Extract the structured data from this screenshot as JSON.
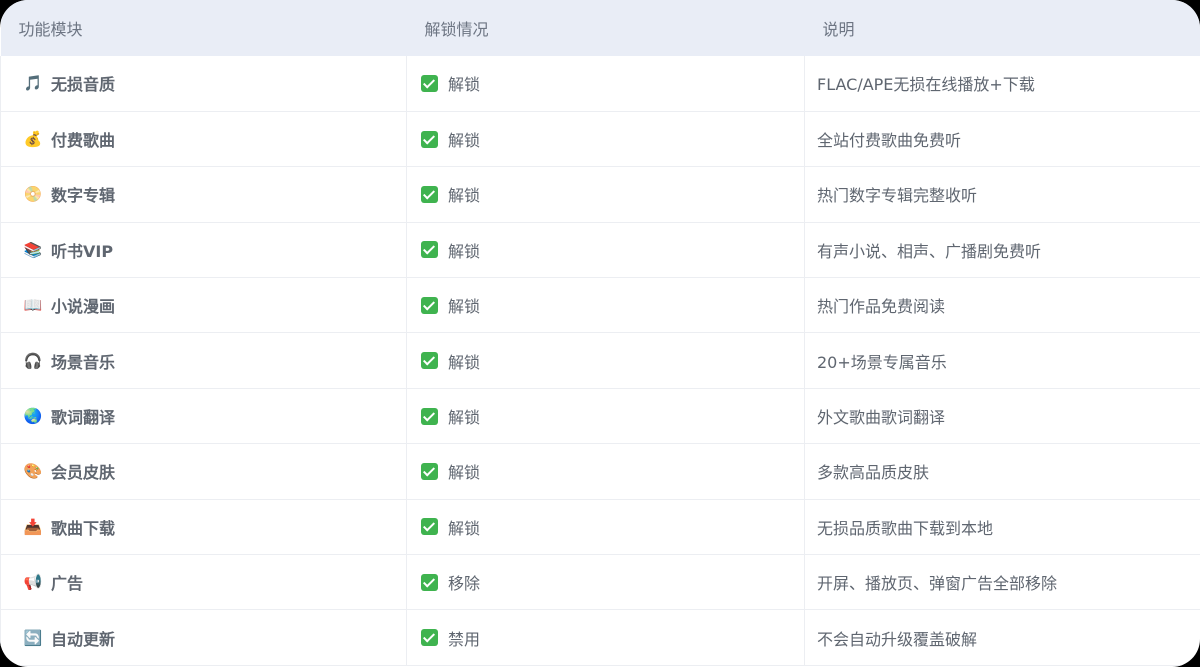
{
  "table": {
    "headers": [
      "功能模块",
      "解锁情况",
      "说明"
    ],
    "rows": [
      {
        "icon": "music-note-icon",
        "glyph": "🎵",
        "feature": "无损音质",
        "status": "解锁",
        "desc": "FLAC/APE无损在线播放+下载"
      },
      {
        "icon": "money-bag-icon",
        "glyph": "💰",
        "feature": "付费歌曲",
        "status": "解锁",
        "desc": "全站付费歌曲免费听"
      },
      {
        "icon": "disc-icon",
        "glyph": "📀",
        "feature": "数字专辑",
        "status": "解锁",
        "desc": "热门数字专辑完整收听"
      },
      {
        "icon": "books-icon",
        "glyph": "📚",
        "feature": "听书VIP",
        "status": "解锁",
        "desc": "有声小说、相声、广播剧免费听"
      },
      {
        "icon": "open-book-icon",
        "glyph": "📖",
        "feature": "小说漫画",
        "status": "解锁",
        "desc": "热门作品免费阅读"
      },
      {
        "icon": "headphones-icon",
        "glyph": "🎧",
        "feature": "场景音乐",
        "status": "解锁",
        "desc": "20+场景专属音乐"
      },
      {
        "icon": "globe-icon",
        "glyph": "🌏",
        "feature": "歌词翻译",
        "status": "解锁",
        "desc": "外文歌曲歌词翻译"
      },
      {
        "icon": "palette-icon",
        "glyph": "🎨",
        "feature": "会员皮肤",
        "status": "解锁",
        "desc": "多款高品质皮肤"
      },
      {
        "icon": "download-icon",
        "glyph": "📥",
        "feature": "歌曲下载",
        "status": "解锁",
        "desc": "无损品质歌曲下载到本地"
      },
      {
        "icon": "megaphone-icon",
        "glyph": "📢",
        "feature": "广告",
        "status": "移除",
        "desc": "开屏、播放页、弹窗广告全部移除"
      },
      {
        "icon": "refresh-icon",
        "glyph": "🔄",
        "feature": "自动更新",
        "status": "禁用",
        "desc": "不会自动升级覆盖破解"
      }
    ]
  },
  "colors": {
    "header_bg": "#e9edf6",
    "check_green": "#3fb34f",
    "text": "#5f6670"
  }
}
